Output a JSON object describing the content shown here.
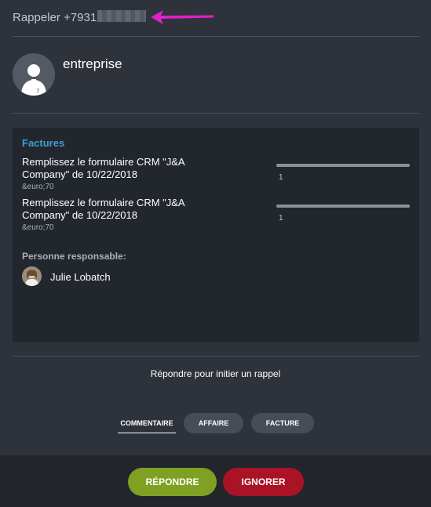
{
  "header": {
    "title": "Rappeler +7931"
  },
  "contact": {
    "name": "entreprise"
  },
  "invoices": {
    "title": "Factures",
    "items": [
      {
        "description": "Remplissez le formulaire CRM \"J&A Company\" de 10/22/2018",
        "amount": "&euro;70",
        "quantity": "1"
      },
      {
        "description": "Remplissez le formulaire CRM \"J&A Company\" de 10/22/2018",
        "amount": "&euro;70",
        "quantity": "1"
      }
    ]
  },
  "responsible": {
    "label": "Personne responsable:",
    "name": "Julie Lobatch"
  },
  "reply_hint": "Répondre pour initier un rappel",
  "tabs": [
    {
      "label": "Commentaire",
      "active": true
    },
    {
      "label": "Affaire",
      "active": false
    },
    {
      "label": "Facture",
      "active": false
    }
  ],
  "actions": {
    "answer_label": "Répondre",
    "ignore_label": "Ignorer"
  },
  "colors": {
    "accent_blue": "#3f9fd0",
    "answer_green": "#7fa022",
    "ignore_red": "#aa1226",
    "annotation_arrow": "#e020c8"
  },
  "icons": {
    "contact_avatar": "user-silhouette-icon",
    "annotation": "arrow-left-annotation"
  }
}
